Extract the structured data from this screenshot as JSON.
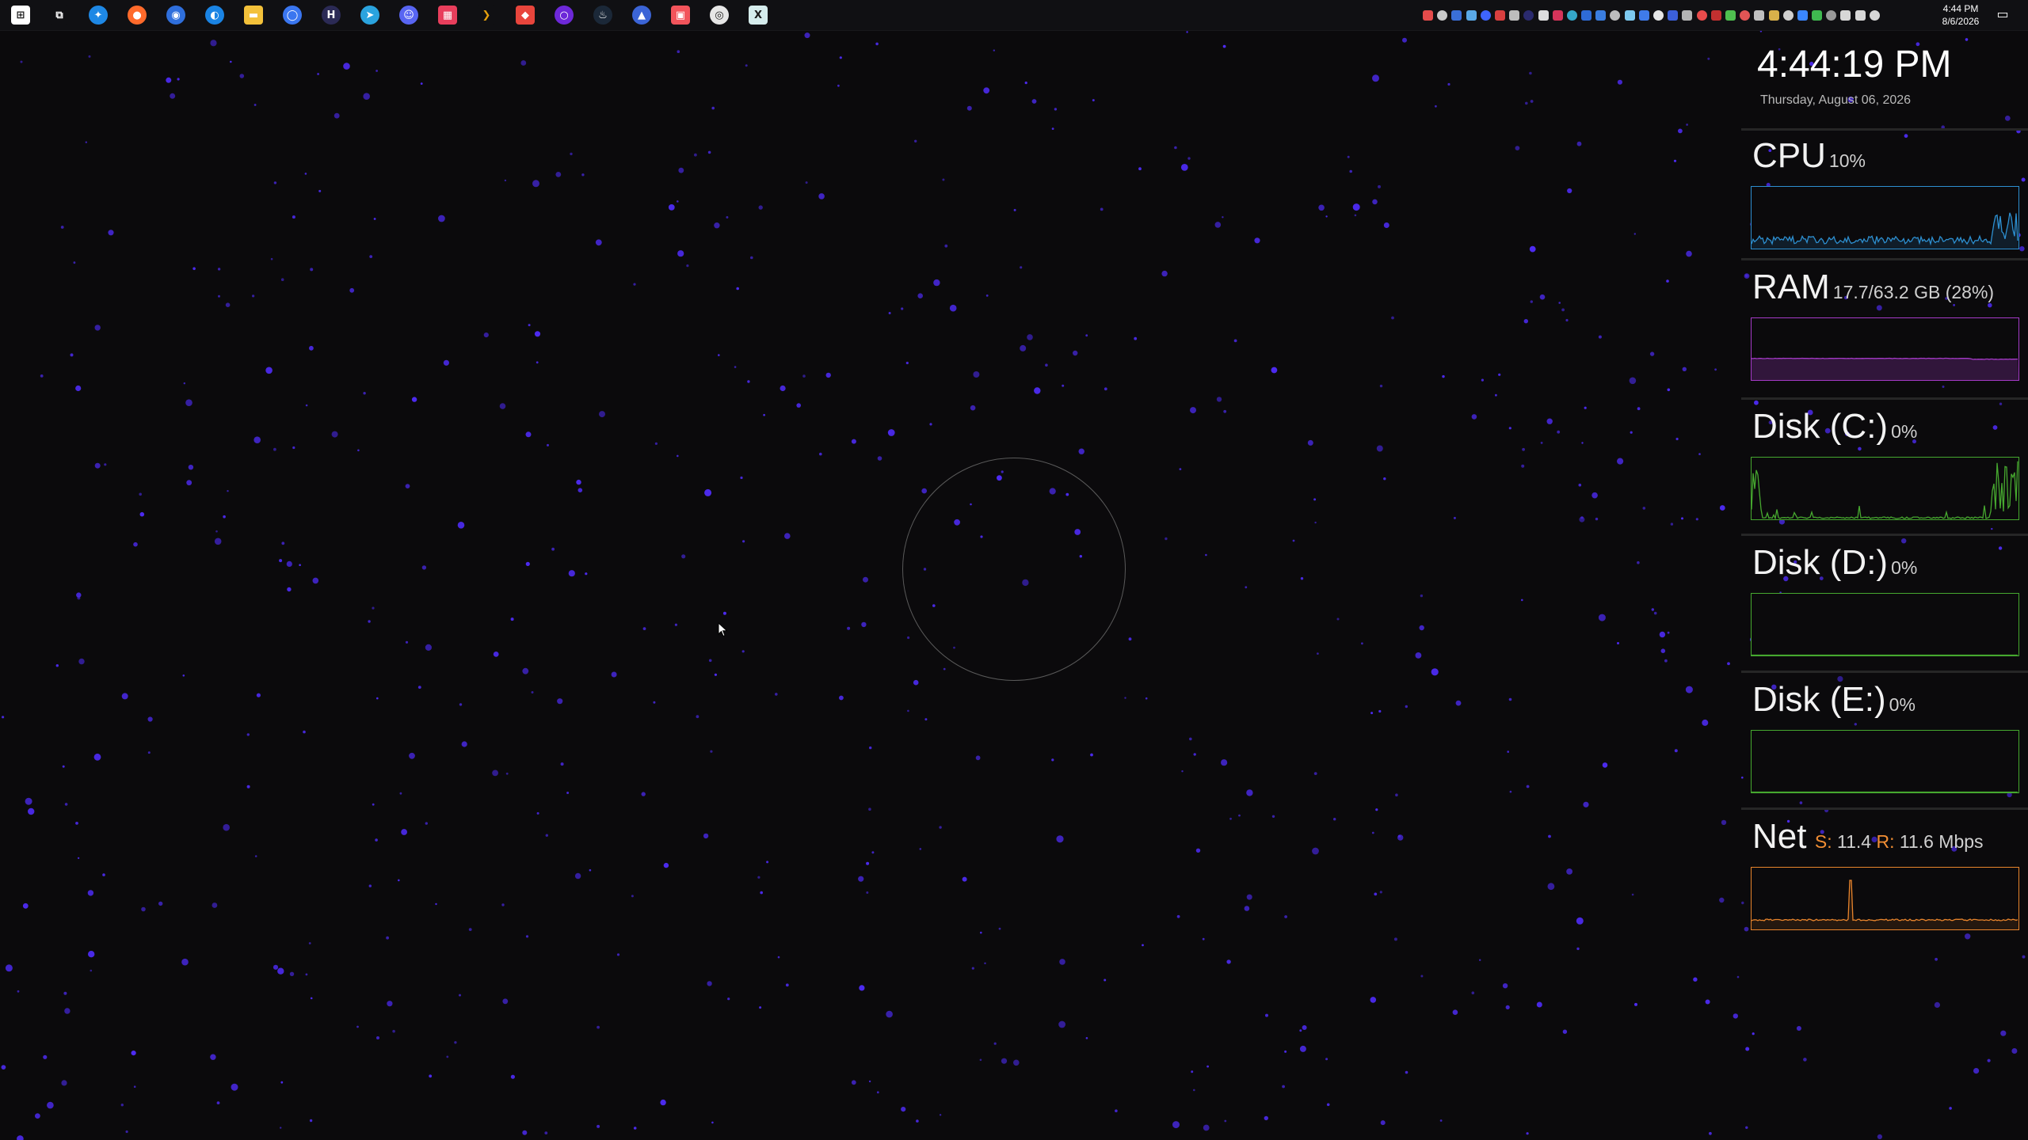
{
  "taskbar": {
    "apps": [
      {
        "name": "start-icon",
        "color": "#ffffff",
        "glyph": "⊞",
        "shape": "sq"
      },
      {
        "name": "task-view-icon",
        "color": "#101013",
        "glyph": "⧉",
        "shape": "sq"
      },
      {
        "name": "browser-icon",
        "color": "#1e88e5",
        "glyph": "✦",
        "shape": "round"
      },
      {
        "name": "firefox-icon",
        "color": "#ff6a2b",
        "glyph": "●",
        "shape": "round"
      },
      {
        "name": "chrome-icon",
        "color": "#2f6fdc",
        "glyph": "◉",
        "shape": "round"
      },
      {
        "name": "edge-icon",
        "color": "#1a84e4",
        "glyph": "◐",
        "shape": "round"
      },
      {
        "name": "file-explorer-icon",
        "color": "#f3c13a",
        "glyph": "▬",
        "shape": "sq"
      },
      {
        "name": "signal-icon",
        "color": "#3a76f0",
        "glyph": "◯",
        "shape": "round"
      },
      {
        "name": "shield-app-icon",
        "color": "#2b2a55",
        "glyph": "H",
        "shape": "round"
      },
      {
        "name": "telegram-icon",
        "color": "#2aa3de",
        "glyph": "➤",
        "shape": "round"
      },
      {
        "name": "discord-icon",
        "color": "#5865f2",
        "glyph": "☺",
        "shape": "round"
      },
      {
        "name": "calendar-app-icon",
        "color": "#e83e5c",
        "glyph": "▦",
        "shape": "sq"
      },
      {
        "name": "plex-icon",
        "color": "#101013",
        "glyph": "❯",
        "shape": "sq"
      },
      {
        "name": "game-controller-icon",
        "color": "#e8453c",
        "glyph": "◆",
        "shape": "sq"
      },
      {
        "name": "obs-ring-icon",
        "color": "#6d28d9",
        "glyph": "○",
        "shape": "round"
      },
      {
        "name": "steam-icon",
        "color": "#1b2838",
        "glyph": "♨",
        "shape": "round"
      },
      {
        "name": "vpn-icon",
        "color": "#3b64d6",
        "glyph": "▲",
        "shape": "round"
      },
      {
        "name": "photo-app-icon",
        "color": "#f2545b",
        "glyph": "▣",
        "shape": "sq"
      },
      {
        "name": "record-icon",
        "color": "#e6e6e6",
        "glyph": "◎",
        "shape": "round"
      },
      {
        "name": "excel-like-icon",
        "color": "#d5ecec",
        "glyph": "X",
        "shape": "sq"
      }
    ],
    "tray_icons": [
      {
        "name": "tray-app-1-icon",
        "color": "#e54b4b"
      },
      {
        "name": "tray-tool-icon",
        "color": "#c9c9c9"
      },
      {
        "name": "tray-app-2-icon",
        "color": "#3a6fd8"
      },
      {
        "name": "tray-app-3-icon",
        "color": "#5aa9e6"
      },
      {
        "name": "tray-app-4-icon",
        "color": "#3e64ff"
      },
      {
        "name": "tray-app-5-icon",
        "color": "#d93f3f"
      },
      {
        "name": "tray-app-6-icon",
        "color": "#bdbdbd"
      },
      {
        "name": "tray-app-7-icon",
        "color": "#2a2a6e"
      },
      {
        "name": "tray-app-8-icon",
        "color": "#dddddd"
      },
      {
        "name": "tray-app-9-icon",
        "color": "#d6345a"
      },
      {
        "name": "tray-app-10-icon",
        "color": "#35a7c9"
      },
      {
        "name": "tray-app-11-icon",
        "color": "#2e6bd6"
      },
      {
        "name": "tray-app-12-icon",
        "color": "#3a7de0"
      },
      {
        "name": "tray-app-13-icon",
        "color": "#bdbdbd"
      },
      {
        "name": "tray-app-14-icon",
        "color": "#7dc9f0"
      },
      {
        "name": "tray-app-15-icon",
        "color": "#3f7bea"
      },
      {
        "name": "tray-send-icon",
        "color": "#e6e6e6"
      },
      {
        "name": "tray-app-16-icon",
        "color": "#3b5fd9"
      },
      {
        "name": "tray-app-17-icon",
        "color": "#b4b4b4"
      },
      {
        "name": "tray-app-18-icon",
        "color": "#e84b4b"
      },
      {
        "name": "tray-app-19-icon",
        "color": "#c23030"
      },
      {
        "name": "tray-app-20-icon",
        "color": "#4fbf4f"
      },
      {
        "name": "tray-app-21-icon",
        "color": "#e25555"
      },
      {
        "name": "tray-app-22-icon",
        "color": "#bfbfbf"
      },
      {
        "name": "tray-app-23-icon",
        "color": "#d8b04a"
      },
      {
        "name": "tray-app-24-icon",
        "color": "#cfcfcf"
      },
      {
        "name": "tray-app-25-icon",
        "color": "#3a86ff"
      },
      {
        "name": "tray-app-26-icon",
        "color": "#3fb950"
      },
      {
        "name": "tray-app-27-icon",
        "color": "#9a9a9a"
      },
      {
        "name": "tray-usb-icon",
        "color": "#d7d7d7"
      },
      {
        "name": "tray-network-icon",
        "color": "#d7d7d7"
      },
      {
        "name": "tray-volume-icon",
        "color": "#d7d7d7"
      }
    ],
    "clock_time": "4:44 PM",
    "clock_date": "8/6/2026",
    "notification_icon": "notification-icon"
  },
  "desktop": {
    "star_color": "#4d2bf2",
    "ring_color": "#5a5a5a"
  },
  "widgets": {
    "time": "4:44:19 PM",
    "date": "Thursday, August 06, 2026",
    "cpu": {
      "label": "CPU",
      "value": "10%",
      "color": "#2d8fd0"
    },
    "ram": {
      "label": "RAM",
      "value": "17.7/63.2 GB (28%)",
      "color": "#a53ac7"
    },
    "disk_c": {
      "label": "Disk (C:)",
      "value": "0%",
      "color": "#46a82f"
    },
    "disk_d": {
      "label": "Disk (D:)",
      "value": "0%",
      "color": "#46a82f"
    },
    "disk_e": {
      "label": "Disk (E:)",
      "value": "0%",
      "color": "#46a82f"
    },
    "net": {
      "label": "Net",
      "send_prefix": "S:",
      "send_value": "11.4",
      "recv_prefix": "R:",
      "recv_value": "11.6 Mbps",
      "color": "#e8842c"
    }
  }
}
